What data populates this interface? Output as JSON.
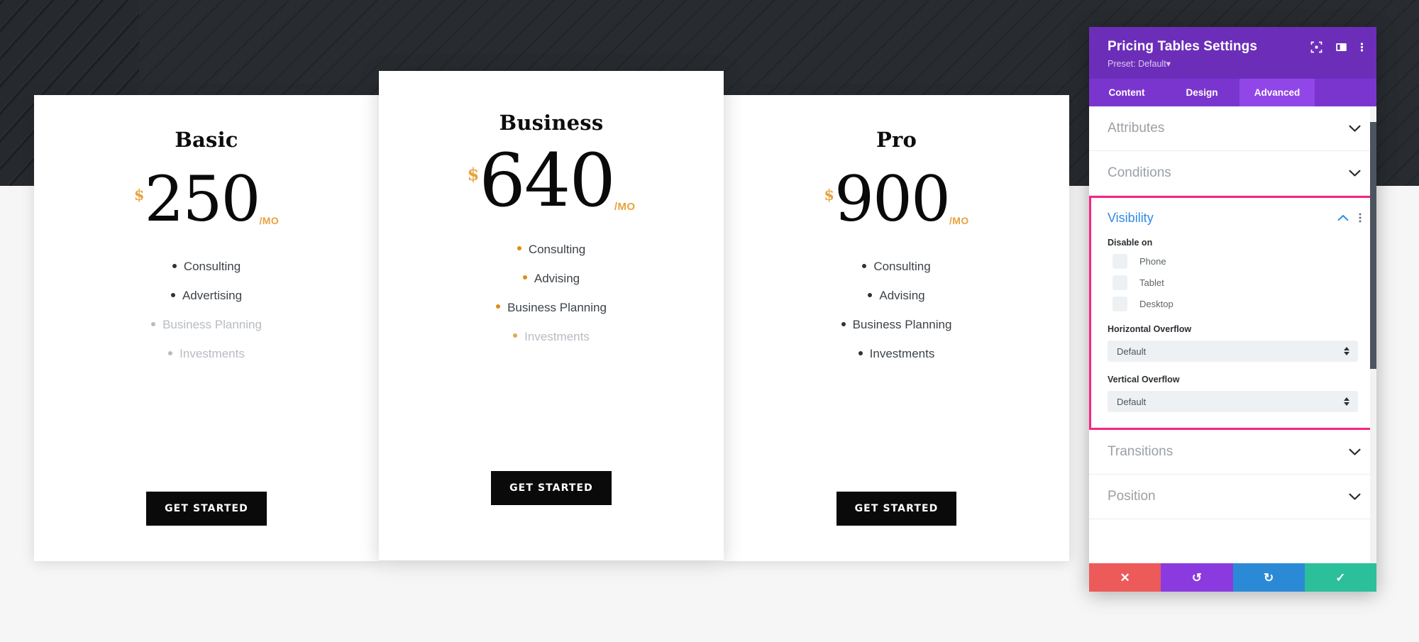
{
  "preview": {
    "pricing_tables": [
      {
        "id": "basic",
        "title": "Basic",
        "currency": "$",
        "price": "250",
        "period": "/MO",
        "features": [
          {
            "label": "Consulting",
            "disabled": false
          },
          {
            "label": "Advertising",
            "disabled": false
          },
          {
            "label": "Business Planning",
            "disabled": true
          },
          {
            "label": "Investments",
            "disabled": true
          }
        ],
        "cta_label": "GET STARTED"
      },
      {
        "id": "business",
        "title": "Business",
        "currency": "$",
        "price": "640",
        "period": "/MO",
        "features": [
          {
            "label": "Consulting",
            "disabled": false
          },
          {
            "label": "Advising",
            "disabled": false
          },
          {
            "label": "Business Planning",
            "disabled": false
          },
          {
            "label": "Investments",
            "disabled": true
          }
        ],
        "cta_label": "GET STARTED"
      },
      {
        "id": "pro",
        "title": "Pro",
        "currency": "$",
        "price": "900",
        "period": "/MO",
        "features": [
          {
            "label": "Consulting",
            "disabled": false
          },
          {
            "label": "Advising",
            "disabled": false
          },
          {
            "label": "Business Planning",
            "disabled": false
          },
          {
            "label": "Investments",
            "disabled": false
          }
        ],
        "cta_label": "GET STARTED"
      }
    ]
  },
  "modal": {
    "title": "Pricing Tables Settings",
    "preset": "Preset: Default",
    "preset_caret": "▾",
    "header_icons": [
      {
        "name": "expand-icon",
        "glyph": "expand"
      },
      {
        "name": "layout-panel-icon",
        "glyph": "panel"
      },
      {
        "name": "more-options-icon",
        "glyph": "kebab"
      }
    ],
    "tabs": [
      {
        "label": "Content",
        "active": false
      },
      {
        "label": "Design",
        "active": false
      },
      {
        "label": "Advanced",
        "active": true
      }
    ],
    "sections_above": [
      {
        "label": "Attributes",
        "expanded": false
      },
      {
        "label": "Conditions",
        "expanded": false
      }
    ],
    "visibility": {
      "title": "Visibility",
      "expanded": true,
      "highlighted": true,
      "highlight_color": "#f72585",
      "title_color": "#2e8ae6",
      "disable_on_label": "Disable on",
      "disable_on_options": [
        {
          "label": "Phone",
          "checked": false
        },
        {
          "label": "Tablet",
          "checked": false
        },
        {
          "label": "Desktop",
          "checked": false
        }
      ],
      "horizontal_overflow_label": "Horizontal Overflow",
      "horizontal_overflow_value": "Default",
      "vertical_overflow_label": "Vertical Overflow",
      "vertical_overflow_value": "Default"
    },
    "sections_below": [
      {
        "label": "Transitions",
        "expanded": false
      },
      {
        "label": "Position",
        "expanded": false
      }
    ],
    "footer_buttons": [
      {
        "name": "cancel-button",
        "glyph": "✕",
        "color": "#ed5a5a"
      },
      {
        "name": "undo-button",
        "glyph": "↺",
        "color": "#8b3ae0"
      },
      {
        "name": "redo-button",
        "glyph": "↻",
        "color": "#2b8ad6"
      },
      {
        "name": "save-button",
        "glyph": "✓",
        "color": "#2bbf9a"
      }
    ]
  }
}
